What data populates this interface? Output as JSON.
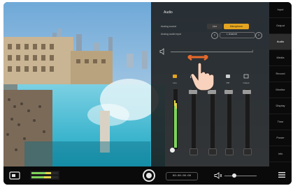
{
  "panel": {
    "title": "Audio",
    "row1_label": "Analog source",
    "row2_label": "Analog audio input",
    "seg_off": "Line",
    "seg_on": "Microphone",
    "channel_value": "L channel"
  },
  "channels": [
    {
      "label": "Line"
    },
    {
      "label": ""
    },
    {
      "label": ""
    },
    {
      "label": "PIP"
    },
    {
      "label": "Output"
    }
  ],
  "sidebar": {
    "items": [
      {
        "label": "Input",
        "active": false
      },
      {
        "label": "Output",
        "active": false
      },
      {
        "label": "Audio",
        "active": true
      },
      {
        "label": "Media",
        "active": false
      },
      {
        "label": "Record",
        "active": false
      },
      {
        "label": "Monitor",
        "active": false
      },
      {
        "label": "Display",
        "active": false
      },
      {
        "label": "Time",
        "active": false
      },
      {
        "label": "Power",
        "active": false
      },
      {
        "label": "Info",
        "active": false
      }
    ]
  },
  "bottombar": {
    "timecode": "00:00:00:00"
  },
  "colors": {
    "accent": "#e4a420",
    "hand_arrow": "#e86a2c"
  },
  "icons": [
    "input-icon",
    "speaker-icon",
    "hand-gesture-icon",
    "record-button-icon",
    "volume-icon",
    "menu-icon"
  ]
}
